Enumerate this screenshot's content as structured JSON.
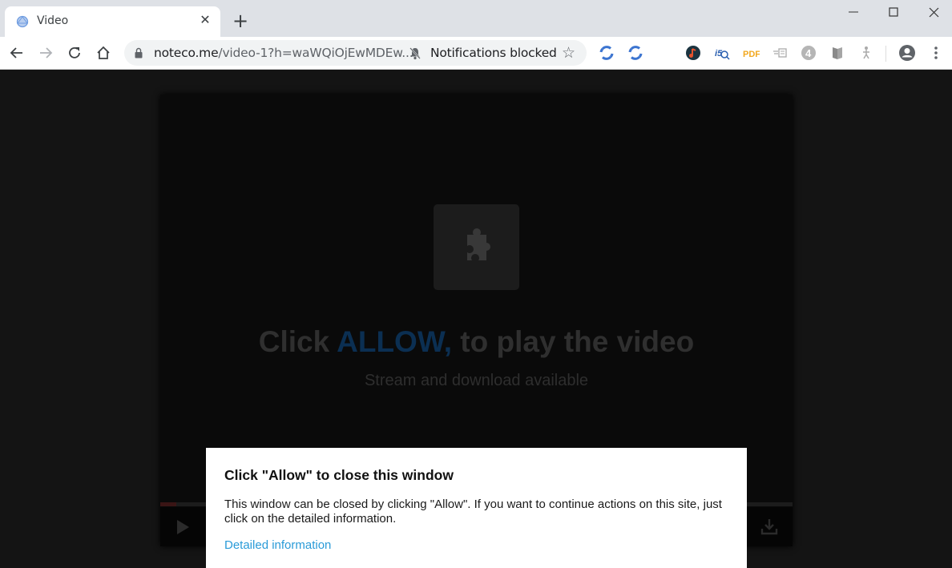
{
  "browser": {
    "tab": {
      "title": "Video",
      "favicon": "globe-icon"
    },
    "new_tab_label": "+",
    "window_controls": [
      "minimize-icon",
      "maximize-icon",
      "close-icon"
    ],
    "address": {
      "domain": "noteco.me",
      "path": "/video-1?h=waWQiOjEwMDEw...",
      "notification_status": "Notifications blocked"
    },
    "nav_icons": [
      "back-arrow-icon",
      "forward-arrow-icon",
      "reload-icon",
      "home-icon"
    ],
    "extensions": [
      "sync-extension-icon",
      "sync-extension-icon",
      "music-extension-icon",
      "search-extension-icon",
      "pdf-extension-icon",
      "arrow-extension-icon",
      "number-four-extension-icon",
      "book-extension-icon",
      "figure-extension-icon"
    ],
    "extension_labels": {
      "pdf": "PDF",
      "four": "4"
    },
    "colors": {
      "tabstrip": "#dee1e6",
      "omnibox": "#f1f3f4",
      "extension_blue": "#3b74d0",
      "pdf_orange": "#f2a81f"
    }
  },
  "player": {
    "headline_prefix": "Click",
    "headline_highlight": "ALLOW,",
    "headline_suffix": "to play the video",
    "subline": "Stream and download available",
    "colors": {
      "highlight": "#0b2f52",
      "background": "#0a0a0a"
    }
  },
  "dialog": {
    "title": "Click \"Allow\" to close this window",
    "body": "This window can be closed by clicking \"Allow\". If you want to continue actions on this site, just click on the detailed information.",
    "link": "Detailed information",
    "colors": {
      "link": "#2a9bd8"
    }
  }
}
